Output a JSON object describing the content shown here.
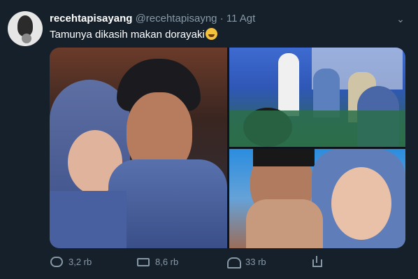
{
  "tweet": {
    "display_name": "recehtapisayang",
    "handle": "@recehtapisayng",
    "separator": "·",
    "date": "11 Agt",
    "text": "Tamunya dikasih makan dorayaki",
    "emoji": "😅"
  },
  "actions": {
    "reply_count": "3,2 rb",
    "retweet_count": "8,6 rb",
    "like_count": "33 rb"
  },
  "icons": [
    "avatar-image",
    "caret-down-icon",
    "reply-icon",
    "retweet-icon",
    "like-icon",
    "share-icon"
  ],
  "colors": {
    "background": "#15202b",
    "secondary_text": "#8899a6",
    "primary_text": "#ffffff"
  }
}
